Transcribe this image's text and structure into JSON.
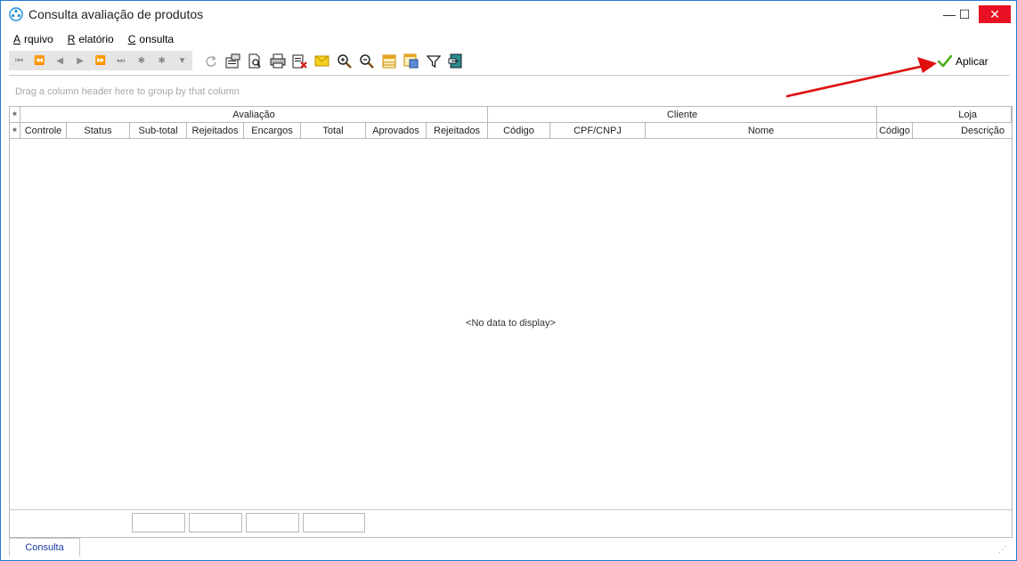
{
  "window": {
    "title": "Consulta avaliação de produtos",
    "min_glyph": "—",
    "max_glyph": "☐",
    "close_glyph": "✕"
  },
  "menu": {
    "items": [
      {
        "first": "A",
        "rest": "rquivo"
      },
      {
        "first": "R",
        "rest": "elatório"
      },
      {
        "first": "C",
        "rest": "onsulta"
      }
    ]
  },
  "navigator": [
    "⏮",
    "⏪",
    "◀",
    "▶",
    "⏩",
    "⏭",
    "✱",
    "✱",
    "▼"
  ],
  "toolbar": {
    "icons": [
      "refresh-icon",
      "properties-icon",
      "preview-icon",
      "print-icon",
      "export-icon",
      "email-icon",
      "zoom-in-icon",
      "zoom-out-icon",
      "grid-layout-icon",
      "column-chooser-icon",
      "filter-icon",
      "exit-icon"
    ],
    "apply_label": "Aplicar"
  },
  "grid": {
    "group_hint": "Drag a column header here to group by that column",
    "bands": [
      "Avaliação",
      "Cliente",
      "Loja"
    ],
    "columns": [
      "Controle",
      "Status",
      "Sub-total",
      "Rejeitados",
      "Encargos",
      "Total",
      "Aprovados",
      "Rejeitados",
      "Código",
      "CPF/CNPJ",
      "Nome",
      "Código",
      "Descrição"
    ],
    "empty_message": "<No data to display>",
    "indicator_glyph": "⁕"
  },
  "tabs": [
    {
      "label": "Consulta"
    }
  ],
  "colors": {
    "window_border": "#2a7ad6",
    "close_button": "#e81123",
    "annotation_arrow": "#e01010",
    "apply_check": "#4caf1e"
  }
}
